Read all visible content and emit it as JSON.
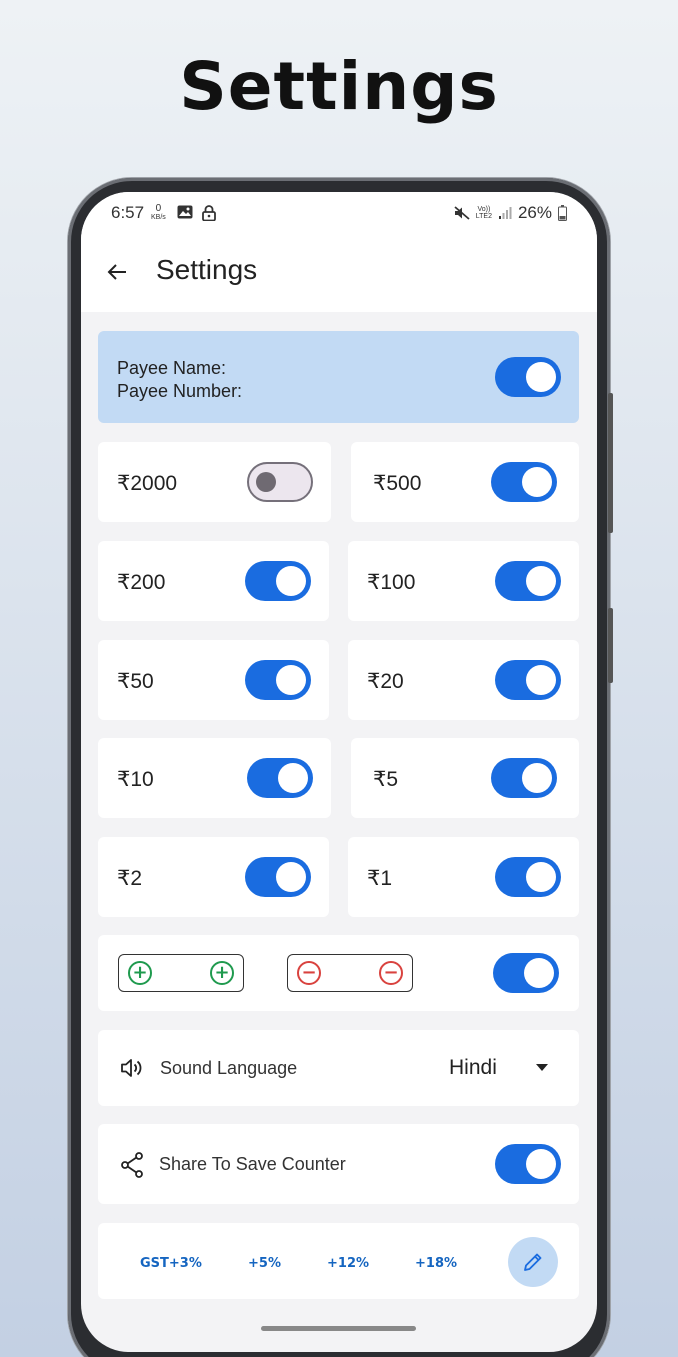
{
  "promo": {
    "title": "Settings"
  },
  "status_bar": {
    "time": "6:57",
    "net_speed_value": "0",
    "net_speed_unit": "KB/s",
    "volte_top": "Vo))",
    "volte_bottom": "LTE2",
    "battery": "26%"
  },
  "app_bar": {
    "title": "Settings"
  },
  "payee": {
    "name_label": "Payee Name:",
    "number_label": "Payee Number:",
    "enabled": true
  },
  "denominations": [
    {
      "label": "₹2000",
      "enabled": false
    },
    {
      "label": "₹500",
      "enabled": true
    },
    {
      "label": "₹200",
      "enabled": true
    },
    {
      "label": "₹100",
      "enabled": true
    },
    {
      "label": "₹50",
      "enabled": true
    },
    {
      "label": "₹20",
      "enabled": true
    },
    {
      "label": "₹10",
      "enabled": true
    },
    {
      "label": "₹5",
      "enabled": true
    },
    {
      "label": "₹2",
      "enabled": true
    },
    {
      "label": "₹1",
      "enabled": true
    }
  ],
  "plus_minus": {
    "plus_symbol": "+",
    "minus_symbol": "−",
    "enabled": true
  },
  "sound_language": {
    "label": "Sound Language",
    "value": "Hindi"
  },
  "share_counter": {
    "label": "Share To Save Counter",
    "enabled": true
  },
  "gst": {
    "options": [
      "GST+3%",
      "+5%",
      "+12%",
      "+18%"
    ]
  },
  "colors": {
    "accent": "#1a6ce0",
    "payee_bg": "#c2daf4",
    "plus": "#1f9a4e",
    "minus": "#d9423e",
    "gst_text": "#1565c0"
  }
}
